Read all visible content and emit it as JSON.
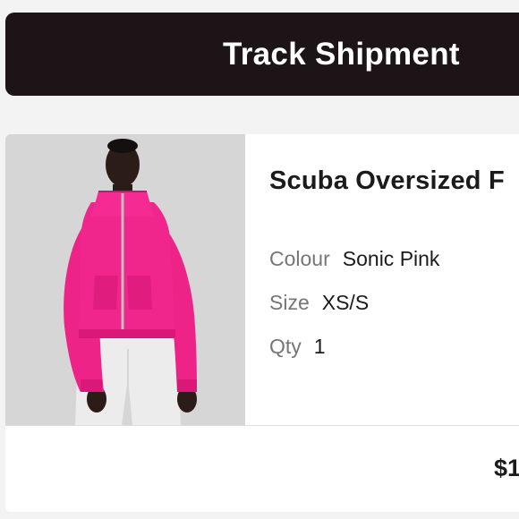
{
  "header": {
    "track_shipment_label": "Track Shipment"
  },
  "product": {
    "title": "Scuba Oversized F",
    "attributes": [
      {
        "label": "Colour",
        "value": "Sonic Pink"
      },
      {
        "label": "Size",
        "value": "XS/S"
      },
      {
        "label": "Qty",
        "value": "1"
      }
    ],
    "price": "$1",
    "image_alt": "model-wearing-pink-half-zip-hoodie"
  },
  "colors": {
    "header_bg": "#1c1416",
    "card_bg": "#ffffff",
    "page_bg": "#f3f3f3",
    "garment_pink": "#f0238a"
  }
}
